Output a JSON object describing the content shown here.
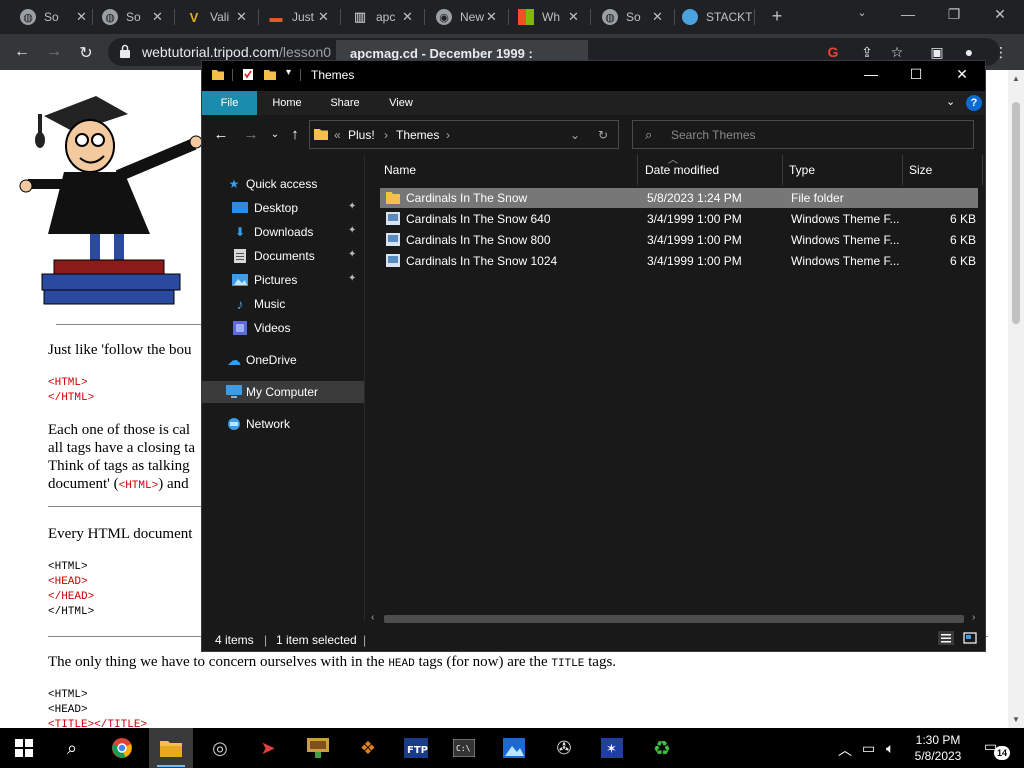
{
  "browser": {
    "tabs": [
      {
        "title": "So",
        "icon": "globe-icon"
      },
      {
        "title": "So",
        "icon": "globe-icon"
      },
      {
        "title": "Vali",
        "icon": "vali-icon"
      },
      {
        "title": "Just",
        "icon": "anvil-icon"
      },
      {
        "title": "apc",
        "icon": "apc-icon"
      },
      {
        "title": "New",
        "icon": "chrome-icon"
      },
      {
        "title": "Wh",
        "icon": "windows-logo-icon"
      },
      {
        "title": "So",
        "icon": "globe-icon"
      },
      {
        "title": "STACKT",
        "icon": "stack-icon"
      }
    ],
    "new_tab": "+",
    "url_host": "webtutorial.tripod.com",
    "url_path": "/lesson0",
    "tab_tooltip": "apcmag.cd - December 1999 :",
    "window_controls": {
      "minimize": "—",
      "restore": "❐",
      "close": "✕"
    }
  },
  "webpage": {
    "line1": "Just like 'follow the bou",
    "code1": [
      "<HTML>",
      "</HTML>"
    ],
    "para2": [
      "Each one of those is cal",
      "all tags have a closing ta",
      "Think of tags as talking",
      "document' ("
    ],
    "para2_code": "<HTML>",
    "para2_end": ") and",
    "line3": "Every HTML document",
    "code2": [
      "<HTML>",
      "<HEAD>",
      "</HEAD>",
      "</HTML>"
    ],
    "line4_pre": "The only thing we have to concern ourselves with in the ",
    "line4_head": "HEAD",
    "line4_mid": " tags (for now) are the ",
    "line4_title": "TITLE",
    "line4_post": " tags.",
    "code3": [
      "<HTML>",
      "<HEAD>",
      "<TITLE></TITLE>"
    ]
  },
  "explorer": {
    "title": "Themes",
    "ribbon_tabs": [
      "File",
      "Home",
      "Share",
      "View"
    ],
    "help": "?",
    "address": {
      "prefix": "«",
      "crumbs": [
        "Plus!",
        "Themes"
      ]
    },
    "search_placeholder": "Search Themes",
    "nav_pane": [
      {
        "label": "Quick access",
        "icon": "star-icon"
      },
      {
        "label": "Desktop",
        "icon": "desktop-icon",
        "pinned": true
      },
      {
        "label": "Downloads",
        "icon": "download-icon",
        "pinned": true
      },
      {
        "label": "Documents",
        "icon": "documents-icon",
        "pinned": true
      },
      {
        "label": "Pictures",
        "icon": "pictures-icon",
        "pinned": true
      },
      {
        "label": "Music",
        "icon": "music-icon"
      },
      {
        "label": "Videos",
        "icon": "videos-icon"
      },
      {
        "label": "OneDrive",
        "icon": "cloud-icon"
      },
      {
        "label": "My Computer",
        "icon": "computer-icon",
        "selected": true
      },
      {
        "label": "Network",
        "icon": "network-icon"
      }
    ],
    "columns": [
      "Name",
      "Date modified",
      "Type",
      "Size"
    ],
    "files": [
      {
        "name": "Cardinals In The Snow",
        "date": "5/8/2023 1:24 PM",
        "type": "File folder",
        "size": "",
        "icon": "folder-icon",
        "selected": true
      },
      {
        "name": "Cardinals In The Snow 640",
        "date": "3/4/1999 1:00 PM",
        "type": "Windows Theme F...",
        "size": "6 KB",
        "icon": "theme-file-icon"
      },
      {
        "name": "Cardinals In The Snow 800",
        "date": "3/4/1999 1:00 PM",
        "type": "Windows Theme F...",
        "size": "6 KB",
        "icon": "theme-file-icon"
      },
      {
        "name": "Cardinals In The Snow 1024",
        "date": "3/4/1999 1:00 PM",
        "type": "Windows Theme F...",
        "size": "6 KB",
        "icon": "theme-file-icon"
      }
    ],
    "status": {
      "count": "4 items",
      "selected": "1 item selected",
      "sep": "|"
    }
  },
  "taskbar": {
    "clock_time": "1:30 PM",
    "clock_date": "5/8/2023",
    "notifications": "14"
  },
  "colors": {
    "accent": "#1a8cad",
    "folder": "#f5c04a",
    "dark_bg": "#191919"
  }
}
